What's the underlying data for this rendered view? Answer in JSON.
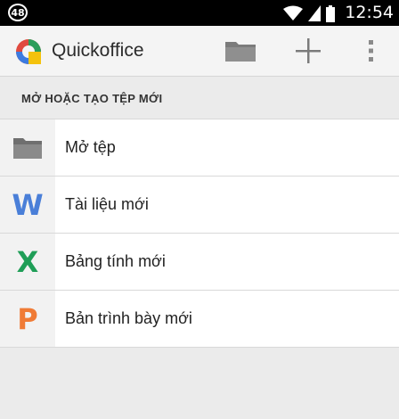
{
  "status_bar": {
    "notification_count": "48",
    "time": "12:54"
  },
  "app_bar": {
    "title": "Quickoffice",
    "actions": [
      {
        "name": "open-folder",
        "icon": "folder-icon"
      },
      {
        "name": "new",
        "icon": "plus-icon"
      },
      {
        "name": "overflow",
        "icon": "more-vert-icon"
      }
    ]
  },
  "section": {
    "title": "MỞ HOẶC TẠO TỆP MỚI"
  },
  "items": [
    {
      "label": "Mở tệp",
      "icon": "folder-icon",
      "color": "#7a7a7a"
    },
    {
      "label": "Tài liệu mới",
      "icon": "word-icon",
      "glyph": "W",
      "color": "#4a7fd8"
    },
    {
      "label": "Bảng tính mới",
      "icon": "spreadsheet-icon",
      "glyph": "X",
      "color": "#1f9e57"
    },
    {
      "label": "Bản trình bày mới",
      "icon": "presentation-icon",
      "glyph": "P",
      "color": "#f07b36"
    }
  ]
}
